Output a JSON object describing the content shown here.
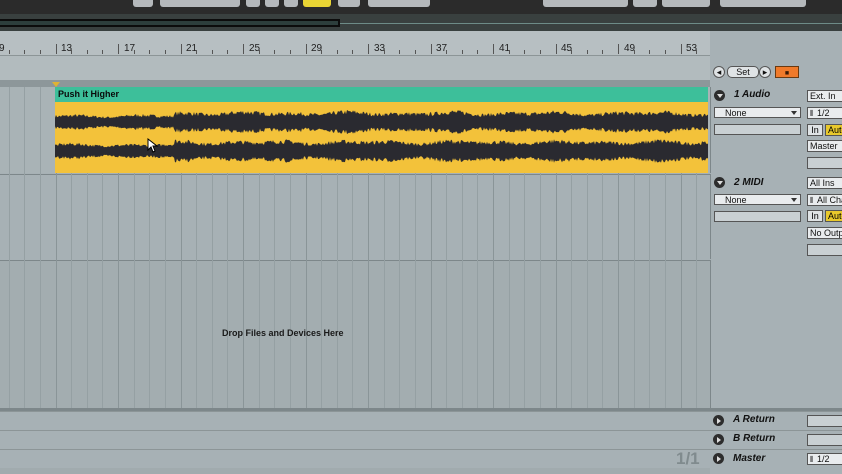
{
  "ruler": {
    "bars": [
      "9",
      "13",
      "17",
      "21",
      "25",
      "29",
      "33",
      "37",
      "41",
      "45",
      "49",
      "53"
    ]
  },
  "controls": {
    "set_label": "Set"
  },
  "clip": {
    "name": "Push it Higher",
    "color": "#3dbf9a",
    "wave_bg": "#f3c23a"
  },
  "tracks": [
    {
      "name": "1 Audio",
      "input_chain": "None",
      "input_type": "Ext. In",
      "input_channel": "1/2",
      "monitor_in": "In",
      "monitor_auto": "Auto",
      "output": "Master"
    },
    {
      "name": "2 MIDI",
      "input_chain": "None",
      "input_type": "All Ins",
      "input_channel": "All Channels",
      "monitor_in": "In",
      "monitor_auto": "Auto",
      "output": "No Output"
    }
  ],
  "drop_area": {
    "text": "Drop Files and Devices Here"
  },
  "returns": [
    {
      "name": "A Return"
    },
    {
      "name": "B Return"
    },
    {
      "name": "Master",
      "output": "1/2"
    }
  ],
  "page_indicator": "1/1"
}
